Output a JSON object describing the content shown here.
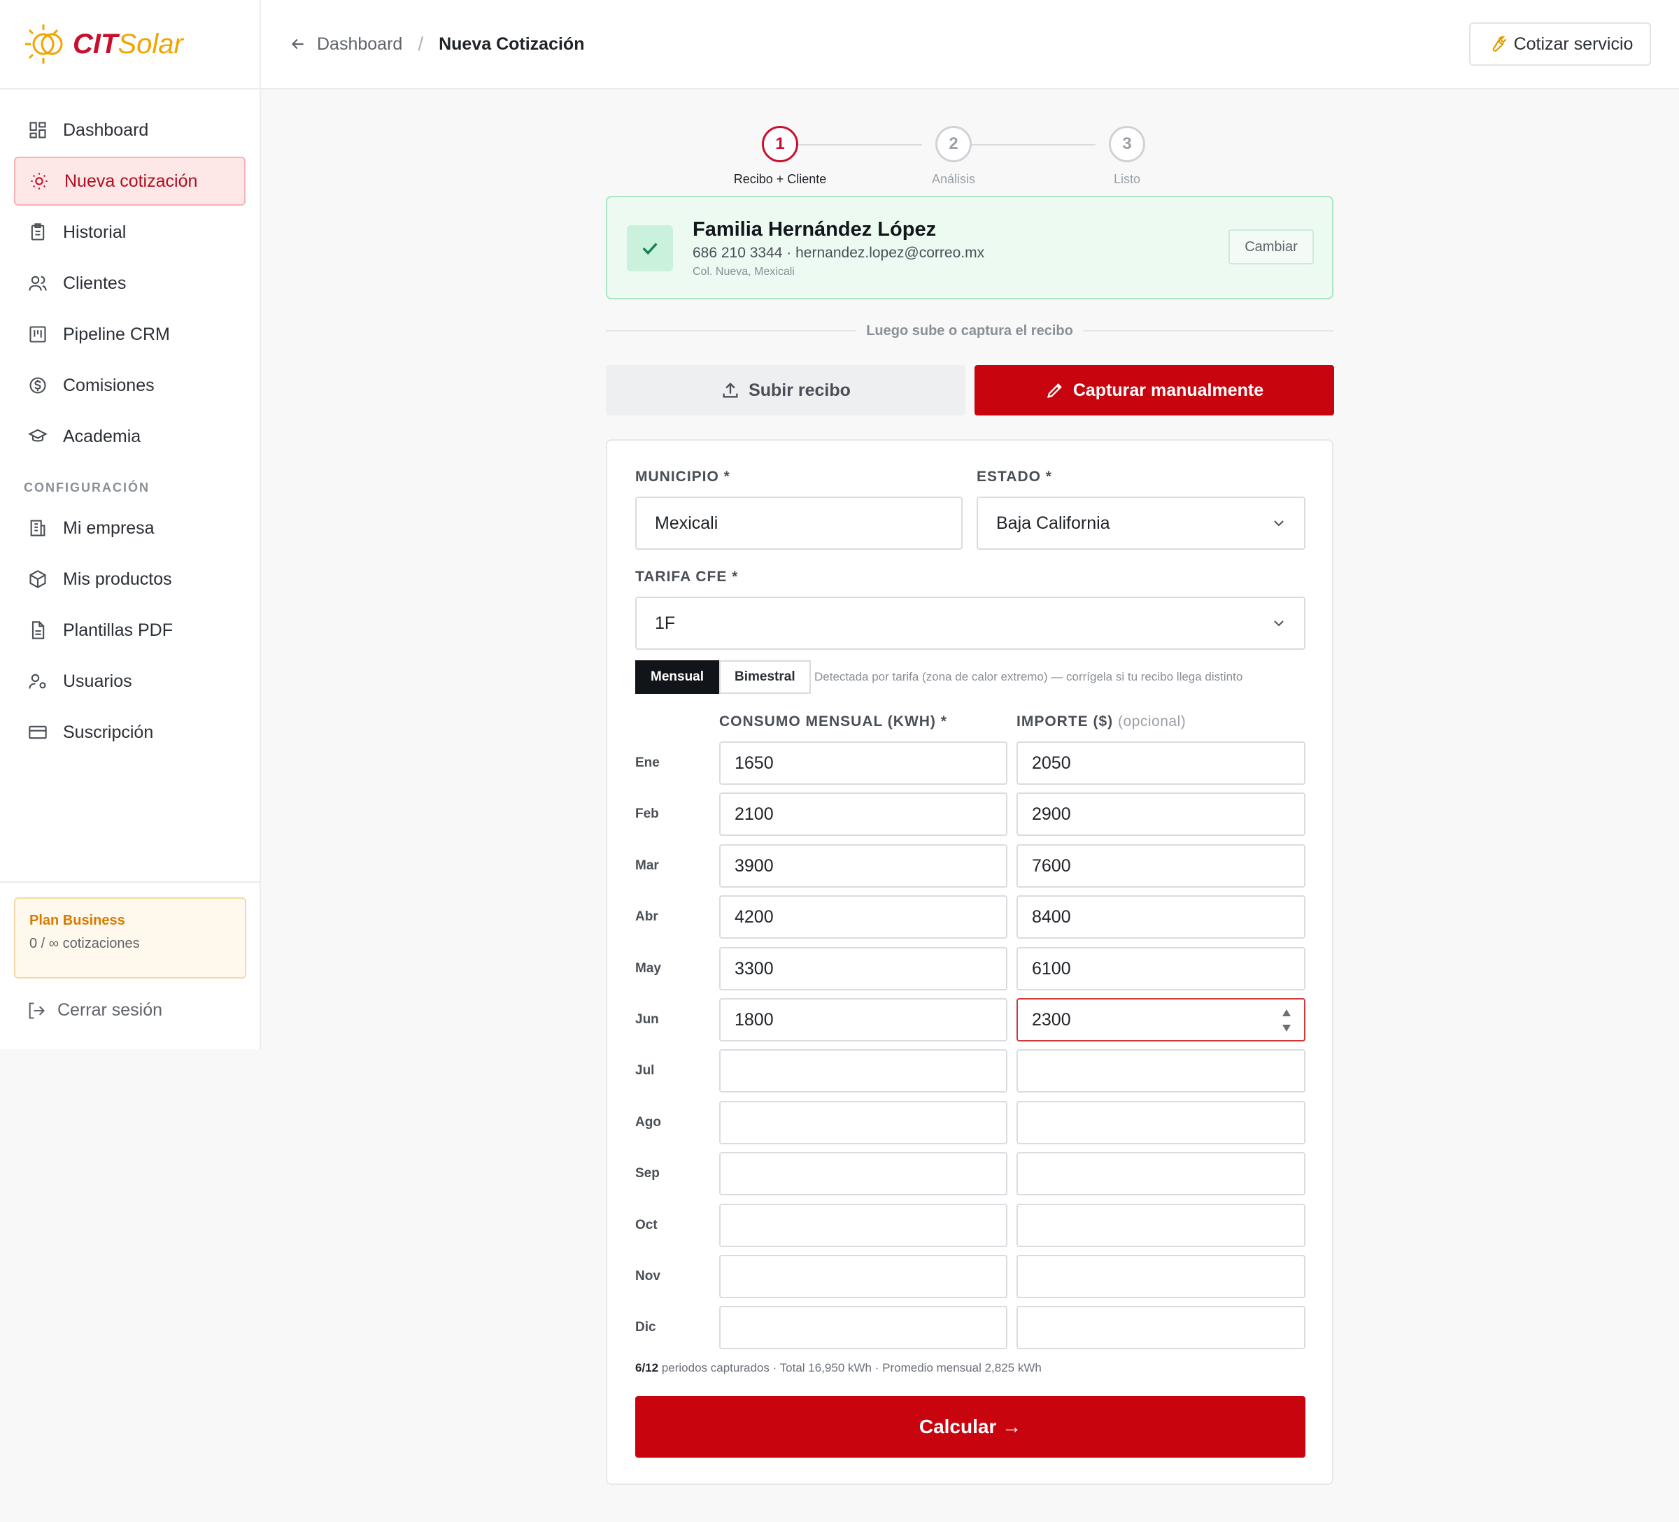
{
  "app": {
    "logo_cit": "CIT",
    "logo_solar": "Solar"
  },
  "sidebar": {
    "items": [
      {
        "label": "Dashboard",
        "icon": "dashboard-icon"
      },
      {
        "label": "Nueva cotización",
        "icon": "sun-icon",
        "active": true
      },
      {
        "label": "Historial",
        "icon": "clipboard-icon"
      },
      {
        "label": "Clientes",
        "icon": "users-icon"
      },
      {
        "label": "Pipeline CRM",
        "icon": "kanban-icon"
      },
      {
        "label": "Comisiones",
        "icon": "dollar-circle-icon"
      },
      {
        "label": "Academia",
        "icon": "graduation-cap-icon"
      }
    ],
    "section_title": "CONFIGURACIÓN",
    "config_items": [
      {
        "label": "Mi empresa",
        "icon": "building-icon"
      },
      {
        "label": "Mis productos",
        "icon": "package-icon"
      },
      {
        "label": "Plantillas PDF",
        "icon": "file-text-icon"
      },
      {
        "label": "Usuarios",
        "icon": "user-gear-icon"
      },
      {
        "label": "Suscripción",
        "icon": "credit-card-icon"
      }
    ],
    "plan": {
      "title": "Plan Business",
      "usage": "0 / ∞ cotizaciones"
    },
    "logout": "Cerrar sesión"
  },
  "header": {
    "back_label": "Dashboard",
    "separator": "/",
    "current": "Nueva Cotización",
    "action_label": "Cotizar servicio"
  },
  "stepper": [
    {
      "num": "1",
      "label": "Recibo + Cliente",
      "active": true
    },
    {
      "num": "2",
      "label": "Análisis"
    },
    {
      "num": "3",
      "label": "Listo"
    }
  ],
  "client": {
    "name": "Familia Hernández López",
    "contact": "686 210 3344 · hernandez.lopez@correo.mx",
    "address": "Col. Nueva, Mexicali",
    "change_label": "Cambiar"
  },
  "divider_text": "Luego sube o captura el recibo",
  "buttons": {
    "upload": "Subir recibo",
    "manual": "Capturar manualmente",
    "calculate": "Calcular →"
  },
  "form": {
    "municipio_label": "MUNICIPIO *",
    "municipio_value": "Mexicali",
    "estado_label": "ESTADO *",
    "estado_value": "Baja California",
    "tarifa_label": "TARIFA CFE *",
    "tarifa_value": "1F",
    "period_options": [
      "Mensual",
      "Bimestral"
    ],
    "period_selected": "Mensual",
    "period_note": "Detectada por tarifa (zona de calor extremo) — corrígela si tu recibo llega distinto",
    "consumo_label": "CONSUMO MENSUAL (KWH) *",
    "importe_label": "IMPORTE ($)",
    "importe_optional": "(opcional)",
    "months": [
      {
        "month": "Ene",
        "kwh": "1650",
        "importe": "2050"
      },
      {
        "month": "Feb",
        "kwh": "2100",
        "importe": "2900"
      },
      {
        "month": "Mar",
        "kwh": "3900",
        "importe": "7600"
      },
      {
        "month": "Abr",
        "kwh": "4200",
        "importe": "8400"
      },
      {
        "month": "May",
        "kwh": "3300",
        "importe": "6100"
      },
      {
        "month": "Jun",
        "kwh": "1800",
        "importe": "2300"
      },
      {
        "month": "Jul",
        "kwh": "",
        "importe": ""
      },
      {
        "month": "Ago",
        "kwh": "",
        "importe": ""
      },
      {
        "month": "Sep",
        "kwh": "",
        "importe": ""
      },
      {
        "month": "Oct",
        "kwh": "",
        "importe": ""
      },
      {
        "month": "Nov",
        "kwh": "",
        "importe": ""
      },
      {
        "month": "Dic",
        "kwh": "",
        "importe": ""
      }
    ],
    "summary_count": "6/12",
    "summary_text": " periodos capturados · Total 16,950 kWh · Promedio mensual 2,825 kWh"
  },
  "colors": {
    "accent": "#c8050f",
    "success_bg": "#ecfaf2",
    "logo_orange": "#f1a500"
  }
}
